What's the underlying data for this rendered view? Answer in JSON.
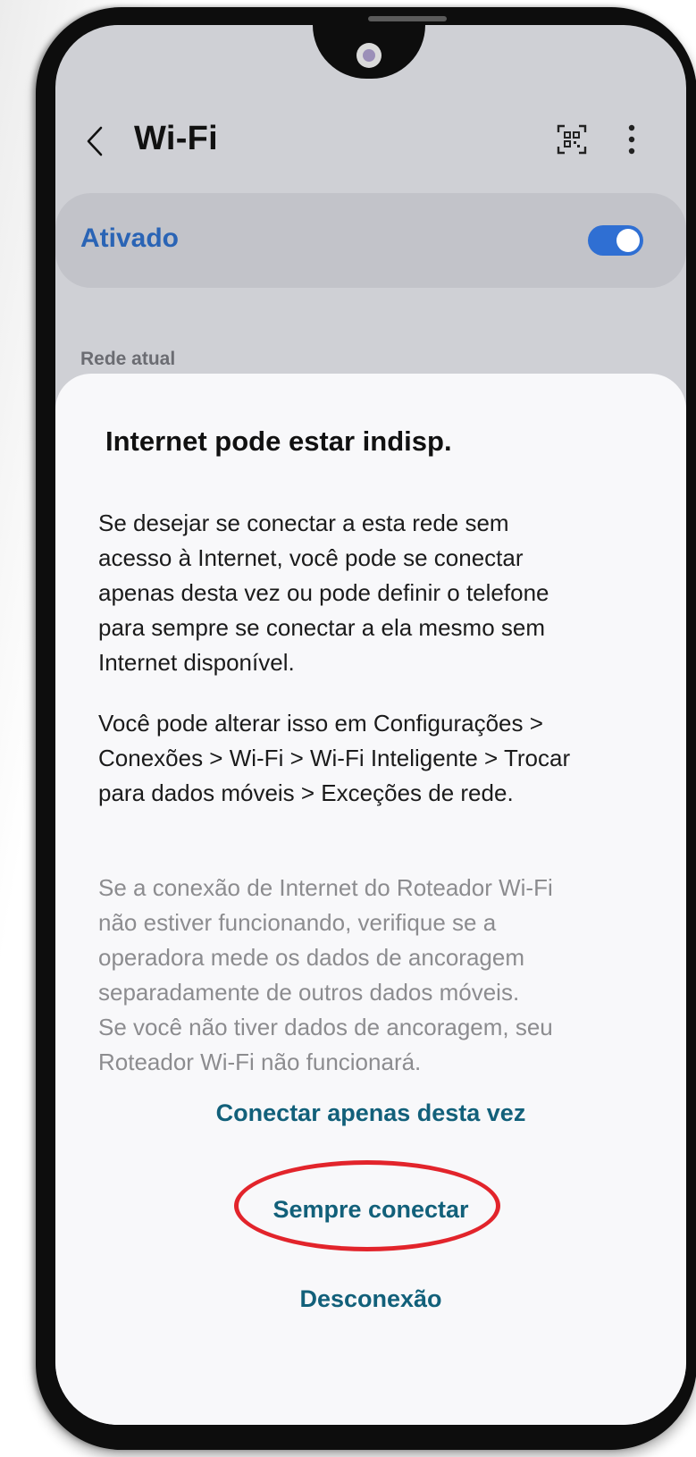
{
  "header": {
    "title": "Wi-Fi"
  },
  "wifi_toggle": {
    "label": "Ativado",
    "state": "on",
    "accent_color": "#2f6fd3"
  },
  "current_network": {
    "section_label": "Rede atual"
  },
  "dialog": {
    "title": "Internet pode estar indisp.",
    "paragraph_1": "Se desejar se conectar a esta rede sem\nacesso à Internet, você pode se conectar\napenas desta vez ou pode definir o telefone\npara sempre se conectar a ela mesmo sem\nInternet disponível.",
    "paragraph_2": "Você pode alterar isso em Configurações >\nConexões > Wi-Fi > Wi-Fi Inteligente > Trocar\npara dados móveis > Exceções de rede.",
    "paragraph_3": "Se a conexão de Internet do Roteador Wi-Fi\nnão estiver funcionando, verifique se a\noperadora mede os dados de ancoragem\nseparadamente de outros dados móveis.\nSe você não tiver dados de ancoragem, seu\nRoteador Wi-Fi não funcionará.",
    "buttons": {
      "connect_once": "Conectar apenas desta vez",
      "always_connect": "Sempre conectar",
      "disconnect": "Desconexão"
    },
    "button_color": "#12607a",
    "highlight_color": "#e2242b"
  },
  "icons": [
    "back-chevron-icon",
    "qr-code-icon",
    "more-options-icon"
  ]
}
